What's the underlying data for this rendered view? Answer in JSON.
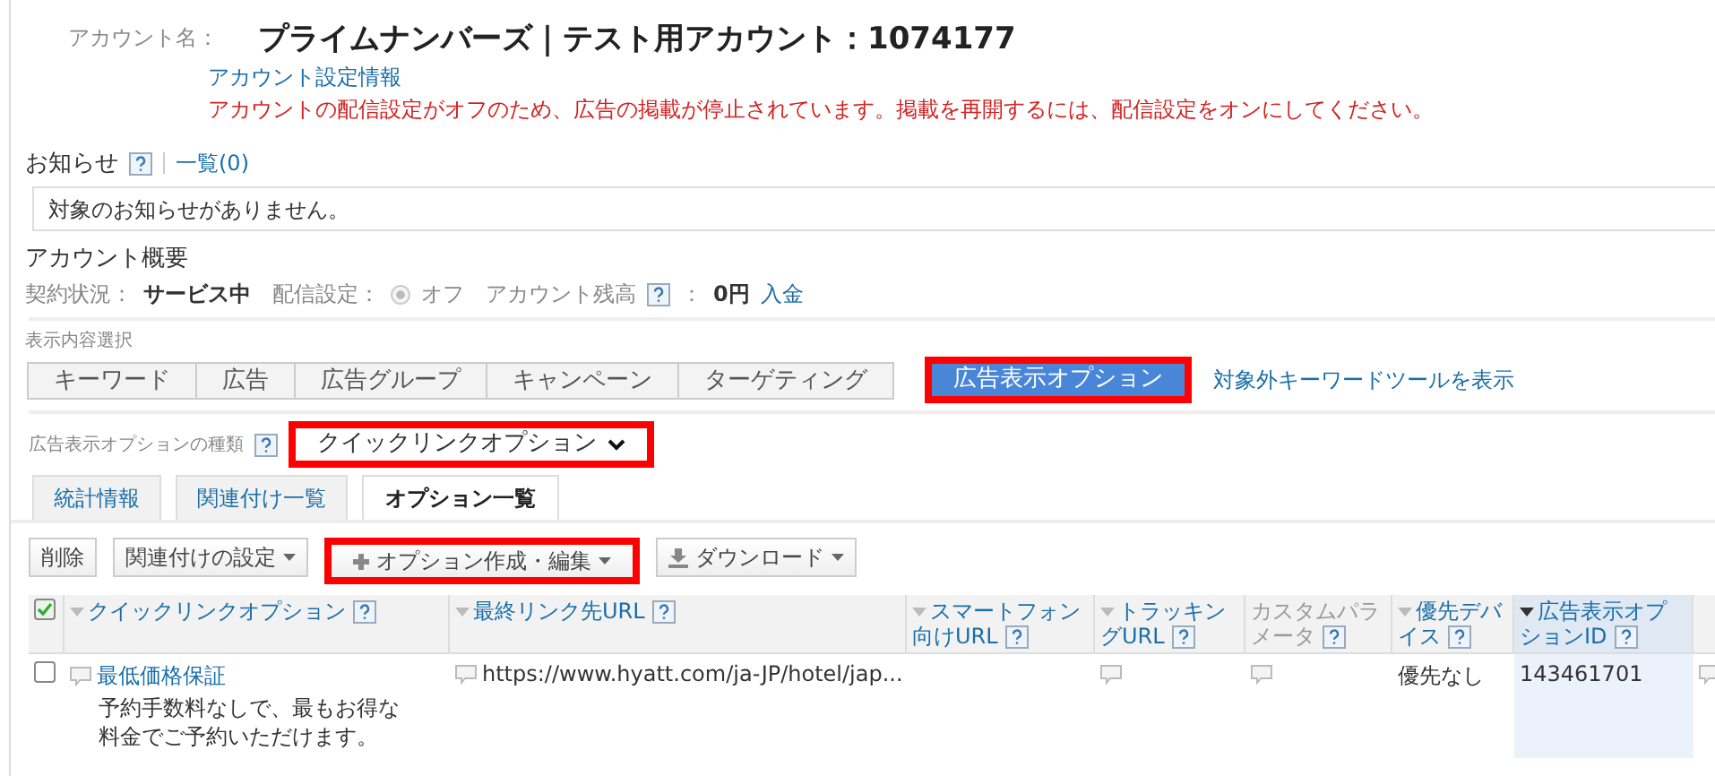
{
  "account": {
    "label": "アカウント名：",
    "name": "プライムナンバーズ｜テスト用アカウント：1074177",
    "settings_link": "アカウント設定情報",
    "warning": "アカウントの配信設定がオフのため、広告の掲載が停止されています。掲載を再開するには、配信設定をオンにしてください。"
  },
  "notices": {
    "title": "お知らせ",
    "list_link": "一覧(0)",
    "message": "対象のお知らせがありません。"
  },
  "overview": {
    "title": "アカウント概要",
    "contract_label": "契約状況：",
    "contract_value": "サービス中",
    "delivery_label": "配信設定：",
    "delivery_option": {
      "label": "オフ",
      "selected": true,
      "disabled": true
    },
    "balance_label": "アカウント残高",
    "balance_colon": "：",
    "balance_value": "0円",
    "deposit_link": "入金"
  },
  "view_select": {
    "label": "表示内容選択",
    "tabs": [
      {
        "label": "キーワード",
        "selected": false,
        "highlighted": false
      },
      {
        "label": "広告",
        "selected": false,
        "highlighted": false
      },
      {
        "label": "広告グループ",
        "selected": false,
        "highlighted": false
      },
      {
        "label": "キャンペーン",
        "selected": false,
        "highlighted": false
      },
      {
        "label": "ターゲティング",
        "selected": false,
        "highlighted": false
      },
      {
        "label": "広告表示オプション",
        "selected": true,
        "highlighted": true
      }
    ],
    "link": "対象外キーワードツールを表示"
  },
  "option_type": {
    "label": "広告表示オプションの種類",
    "value": "クイックリンクオプション",
    "highlighted": true
  },
  "subtabs": [
    {
      "label": "統計情報",
      "selected": false
    },
    {
      "label": "関連付け一覧",
      "selected": false
    },
    {
      "label": "オプション一覧",
      "selected": true
    }
  ],
  "toolbar": [
    {
      "label": "削除",
      "kind": "plain",
      "highlighted": false
    },
    {
      "label": "関連付けの設定",
      "kind": "menu",
      "highlighted": false
    },
    {
      "label": "オプション作成・編集",
      "kind": "create",
      "highlighted": true
    },
    {
      "label": "ダウンロード",
      "kind": "download",
      "highlighted": false
    }
  ],
  "table": {
    "all_checked": true,
    "columns": [
      {
        "label": "クイックリンクオプション",
        "sortable": true,
        "sorted": false
      },
      {
        "label": "最終リンク先URL",
        "sortable": true,
        "sorted": false
      },
      {
        "label": "スマートフォン向けURL",
        "sortable": true,
        "sorted": false
      },
      {
        "label": "トラッキングURL",
        "sortable": true,
        "sorted": false
      },
      {
        "label": "カスタムパラメータ",
        "sortable": false,
        "sorted": false
      },
      {
        "label": "優先デバイス",
        "sortable": true,
        "sorted": false
      },
      {
        "label": "広告表示オプションID",
        "sortable": true,
        "sorted": true
      }
    ],
    "rows": [
      {
        "checked": false,
        "title": "最低価格保証",
        "description": "予約手数料なしで、最もお得な料金でご予約いただけます。",
        "url": "https://www.hyatt.com/ja-JP/hotel/jap...",
        "device": "優先なし",
        "id": "143461701"
      }
    ]
  }
}
